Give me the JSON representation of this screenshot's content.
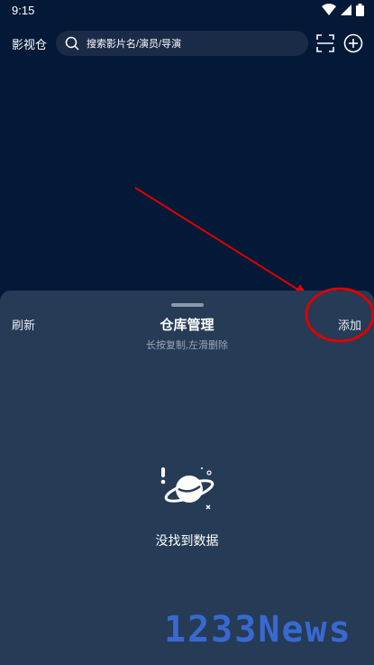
{
  "status_bar": {
    "time": "9:15"
  },
  "header": {
    "app_title": "影视仓",
    "search_placeholder": "搜索影片名/演员/导演"
  },
  "sheet": {
    "refresh_label": "刷新",
    "title": "仓库管理",
    "subtitle": "长按复制,左滑删除",
    "add_label": "添加",
    "empty_text": "没找到数据"
  },
  "watermark": {
    "text": "1233News"
  },
  "colors": {
    "background": "#041937",
    "sheet": "#263b55",
    "annotation": "#e00000",
    "watermark": "#3b6fe0"
  }
}
